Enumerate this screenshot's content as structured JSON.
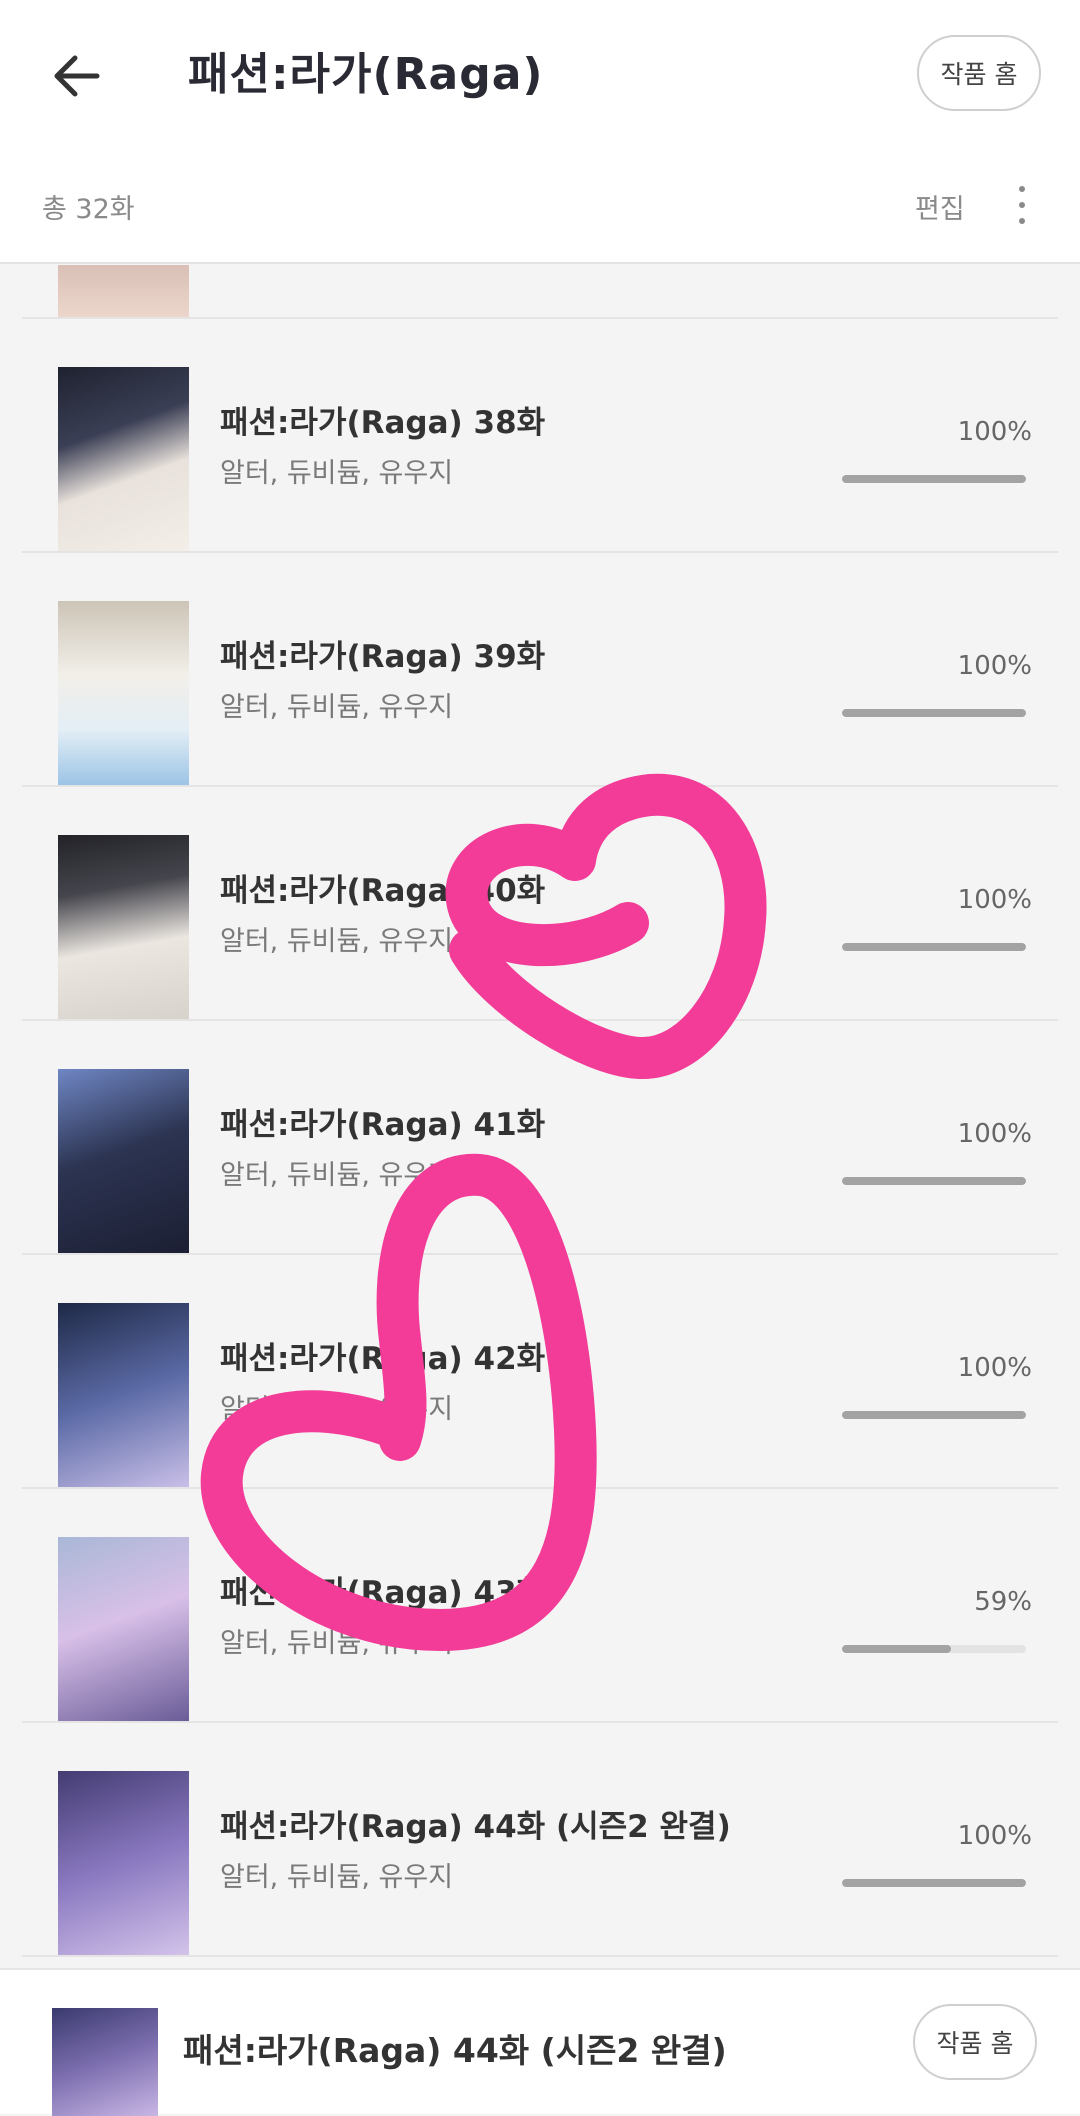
{
  "header": {
    "title": "패션:라가(Raga)",
    "home_label": "작품 홈",
    "count_label": "총 32화",
    "edit_label": "편집",
    "back_icon": "arrow-left-icon",
    "more_icon": "more-vertical-icon"
  },
  "episodes": [
    {
      "title": "패션:라가(Raga) 38화",
      "authors": "알터, 듀비듐, 유우지",
      "progress_text": "100%",
      "progress": 1.0
    },
    {
      "title": "패션:라가(Raga) 39화",
      "authors": "알터, 듀비듐, 유우지",
      "progress_text": "100%",
      "progress": 1.0
    },
    {
      "title": "패션:라가(Raga) 40화",
      "authors": "알터, 듀비듐, 유우지",
      "progress_text": "100%",
      "progress": 1.0
    },
    {
      "title": "패션:라가(Raga) 41화",
      "authors": "알터, 듀비듐, 유우지",
      "progress_text": "100%",
      "progress": 1.0
    },
    {
      "title": "패션:라가(Raga) 42화",
      "authors": "알터, 듀비듐, 유우지",
      "progress_text": "100%",
      "progress": 1.0
    },
    {
      "title": "패션:라가(Raga) 43화",
      "authors": "알터, 듀비듐, 유우지",
      "progress_text": "59%",
      "progress": 0.59
    },
    {
      "title": "패션:라가(Raga) 44화 (시즌2 완결)",
      "authors": "알터, 듀비듐, 유우지",
      "progress_text": "100%",
      "progress": 1.0
    }
  ],
  "bottom_bar": {
    "title": "패션:라가(Raga) 44화 (시즌2 완결)",
    "home_label": "작품 홈"
  },
  "colors": {
    "heart_doodle": "#f23c98",
    "progress_fill": "#a3a3a3",
    "background": "#f4f4f4"
  }
}
